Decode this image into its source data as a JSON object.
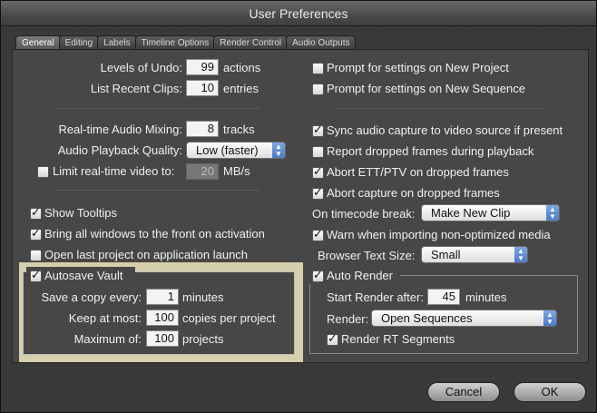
{
  "window": {
    "title": "User Preferences"
  },
  "tabs": [
    "General",
    "Editing",
    "Labels",
    "Timeline Options",
    "Render Control",
    "Audio Outputs"
  ],
  "left": {
    "levels_of_undo": {
      "label": "Levels of Undo:",
      "value": "99",
      "unit": "actions"
    },
    "list_recent_clips": {
      "label": "List Recent Clips:",
      "value": "10",
      "unit": "entries"
    },
    "realtime_audio_mixing": {
      "label": "Real-time Audio Mixing:",
      "value": "8",
      "unit": "tracks"
    },
    "audio_playback_quality": {
      "label": "Audio Playback Quality:",
      "value": "Low (faster)"
    },
    "limit_realtime_video": {
      "label": "Limit real-time video to:",
      "value": "20",
      "unit": "MB/s",
      "checked": false
    },
    "show_tooltips": {
      "label": "Show Tooltips",
      "checked": true
    },
    "bring_windows_front": {
      "label": "Bring all windows to the front on activation",
      "checked": true
    },
    "open_last_project": {
      "label": "Open last project on application launch",
      "checked": false
    },
    "autosave": {
      "label": "Autosave Vault",
      "checked": true,
      "save_copy": {
        "label": "Save a copy every:",
        "value": "1",
        "unit": "minutes"
      },
      "keep_at_most": {
        "label": "Keep at most:",
        "value": "100",
        "unit": "copies per project"
      },
      "maximum_of": {
        "label": "Maximum of:",
        "value": "100",
        "unit": "projects"
      }
    }
  },
  "right": {
    "prompt_new_project": {
      "label": "Prompt for settings on New Project",
      "checked": false
    },
    "prompt_new_sequence": {
      "label": "Prompt for settings on New Sequence",
      "checked": false
    },
    "sync_audio_capture": {
      "label": "Sync audio capture to video source if present",
      "checked": true
    },
    "report_dropped_frames": {
      "label": "Report dropped frames during playback",
      "checked": false
    },
    "abort_ett_ptv": {
      "label": "Abort ETT/PTV on dropped frames",
      "checked": true
    },
    "abort_capture": {
      "label": "Abort capture on dropped frames",
      "checked": true
    },
    "timecode_break": {
      "label": "On timecode break:",
      "value": "Make New Clip"
    },
    "warn_non_optimized": {
      "label": "Warn when importing non-optimized media",
      "checked": true
    },
    "browser_text_size": {
      "label": "Browser Text Size:",
      "value": "Small"
    },
    "auto_render": {
      "label": "Auto Render",
      "checked": true,
      "start_after": {
        "label": "Start Render after:",
        "value": "45",
        "unit": "minutes"
      },
      "render": {
        "label": "Render:",
        "value": "Open Sequences"
      },
      "render_rt_segments": {
        "label": "Render RT Segments",
        "checked": true
      }
    }
  },
  "buttons": {
    "cancel": "Cancel",
    "ok": "OK"
  },
  "icons": {
    "popup_arrow": "up-down-arrows-icon",
    "checkbox": "checkmark-icon"
  },
  "colors": {
    "highlight": "#d6cfae",
    "popup_arrow": "#4a7bc8"
  }
}
